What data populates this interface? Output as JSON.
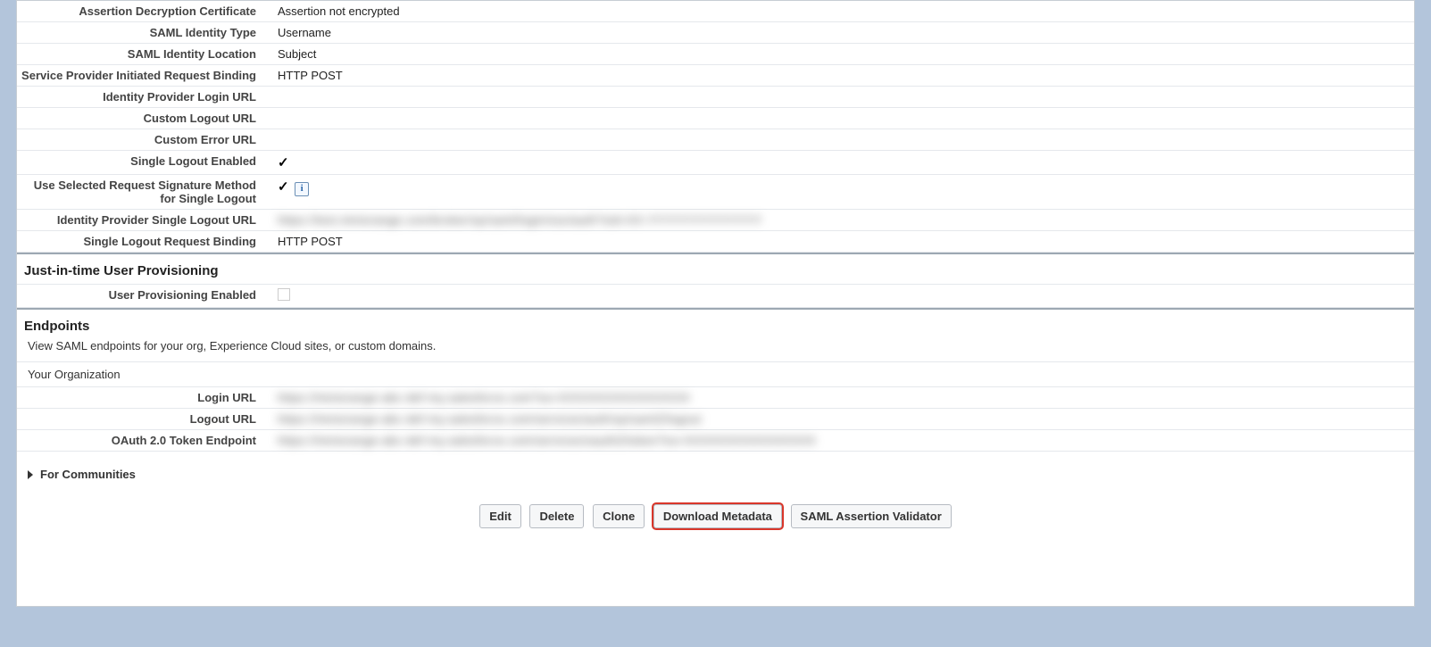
{
  "fields": {
    "assertion_decryption_cert": {
      "label": "Assertion Decryption Certificate",
      "value": "Assertion not encrypted"
    },
    "saml_identity_type": {
      "label": "SAML Identity Type",
      "value": "Username"
    },
    "saml_identity_location": {
      "label": "SAML Identity Location",
      "value": "Subject"
    },
    "sp_init_req_binding": {
      "label": "Service Provider Initiated Request Binding",
      "value": "HTTP POST"
    },
    "idp_login_url": {
      "label": "Identity Provider Login URL",
      "value": ""
    },
    "custom_logout_url": {
      "label": "Custom Logout URL",
      "value": ""
    },
    "custom_error_url": {
      "label": "Custom Error URL",
      "value": ""
    },
    "single_logout_enabled": {
      "label": "Single Logout Enabled"
    },
    "use_sel_req_sig_method_slo": {
      "label": "Use Selected Request Signature Method for Single Logout"
    },
    "idp_slo_url": {
      "label": "Identity Provider Single Logout URL",
      "value": "https://test.miniorange.com/broker/sp/saml/login/sso/auth?sid=XX-YYYYYYYYYYYYYY"
    },
    "slo_request_binding": {
      "label": "Single Logout Request Binding",
      "value": "HTTP POST"
    }
  },
  "sections": {
    "jit": {
      "title": "Just-in-time User Provisioning",
      "user_prov_enabled_label": "User Provisioning Enabled"
    },
    "endpoints": {
      "title": "Endpoints",
      "subtitle": "View SAML endpoints for your org, Experience Cloud sites, or custom domains.",
      "org_header": "Your Organization",
      "login_url": {
        "label": "Login URL",
        "value": "https://miniorange-abc-def-my.salesforce.com?so=XXXXXXXXXXXXXXXX"
      },
      "logout_url": {
        "label": "Logout URL",
        "value": "https://miniorange-abc-def-my.salesforce.com/services/auth/sp/saml2/logout"
      },
      "oauth_token_endpoint": {
        "label": "OAuth 2.0 Token Endpoint",
        "value": "https://miniorange-abc-def-my.salesforce.com/services/oauth2/token?so=XXXXXXXXXXXXXXXX"
      }
    },
    "for_communities": {
      "label": "For Communities"
    }
  },
  "buttons": {
    "edit": "Edit",
    "delete": "Delete",
    "clone": "Clone",
    "download_metadata": "Download Metadata",
    "saml_assertion_validator": "SAML Assertion Validator"
  }
}
